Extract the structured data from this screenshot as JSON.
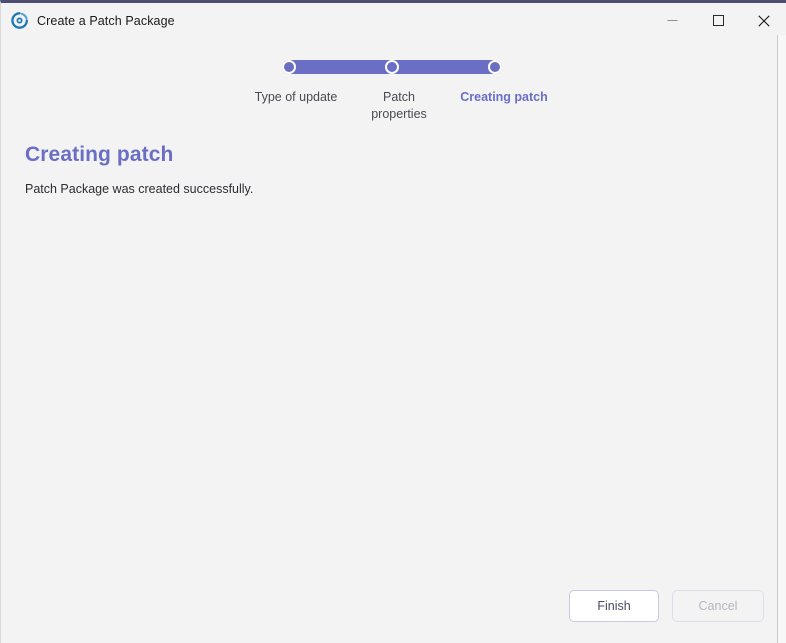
{
  "window": {
    "title": "Create a Patch Package",
    "app_icon": "patch-package-logo-icon",
    "controls": {
      "minimize_label": "Minimize",
      "maximize_label": "Maximize",
      "close_label": "Close"
    }
  },
  "stepper": {
    "current_step": 3,
    "total_steps": 3,
    "steps": [
      {
        "label": "Type of update",
        "state": "complete"
      },
      {
        "label": "Patch\nproperties",
        "state": "complete"
      },
      {
        "label": "Creating patch",
        "state": "active"
      }
    ],
    "accent_color": "#6a6ec4"
  },
  "main": {
    "title": "Creating patch",
    "description": "Patch Package was created successfully."
  },
  "footer": {
    "finish_label": "Finish",
    "cancel_label": "Cancel",
    "cancel_disabled": true
  },
  "colors": {
    "accent": "#6a6ec4",
    "title_bar_top": "#4e4e74",
    "background": "#f3f3f3",
    "text": "#2d2d33",
    "muted_text": "#4a4a55",
    "disabled_text": "#b5b5c6"
  }
}
